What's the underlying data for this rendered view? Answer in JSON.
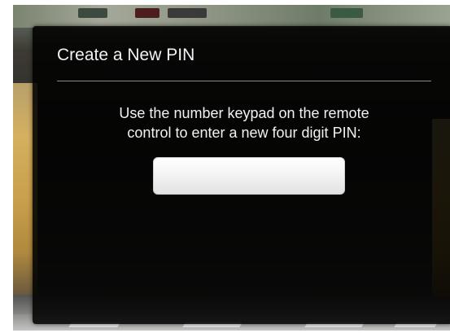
{
  "dialog": {
    "title": "Create a New PIN",
    "instruction_line1": "Use the number keypad on the remote",
    "instruction_line2": "control to enter a new four digit PIN:",
    "pin_value": ""
  },
  "colors": {
    "dialog_background": "#000000",
    "text": "#f2f2f2",
    "divider": "#8a8a8a",
    "pin_field": "#f0f0f0"
  }
}
